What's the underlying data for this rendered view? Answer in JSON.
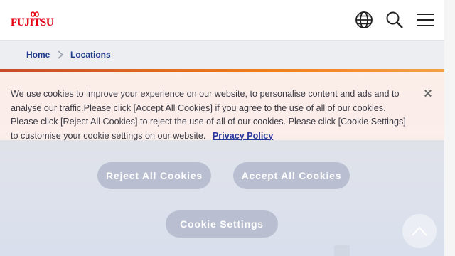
{
  "brand": {
    "logo_text": "FUJITSU"
  },
  "header": {
    "icons": [
      "globe-icon",
      "search-icon",
      "menu-icon"
    ]
  },
  "breadcrumb": {
    "home": "Home",
    "current": "Locations"
  },
  "cookie_banner": {
    "message": "We use cookies to improve your experience on our website, to personalise content and ads and to analyse our traffic.Please click [Accept All Cookies] if you agree to the use of all of our cookies. Please click [Reject All Cookies] to reject the use of all of our cookies. Please click [Cookie Settings] to customise your cookie settings on our website.",
    "privacy_link": "Privacy Policy",
    "close_symbol": "×",
    "reject_label": "Reject All Cookies",
    "accept_label": "Accept All Cookies",
    "settings_label": "Cookie Settings"
  },
  "colors": {
    "brand_red": "#e60012",
    "link_blue": "#1e3a8a",
    "button_fill": "#b9bfd0"
  }
}
